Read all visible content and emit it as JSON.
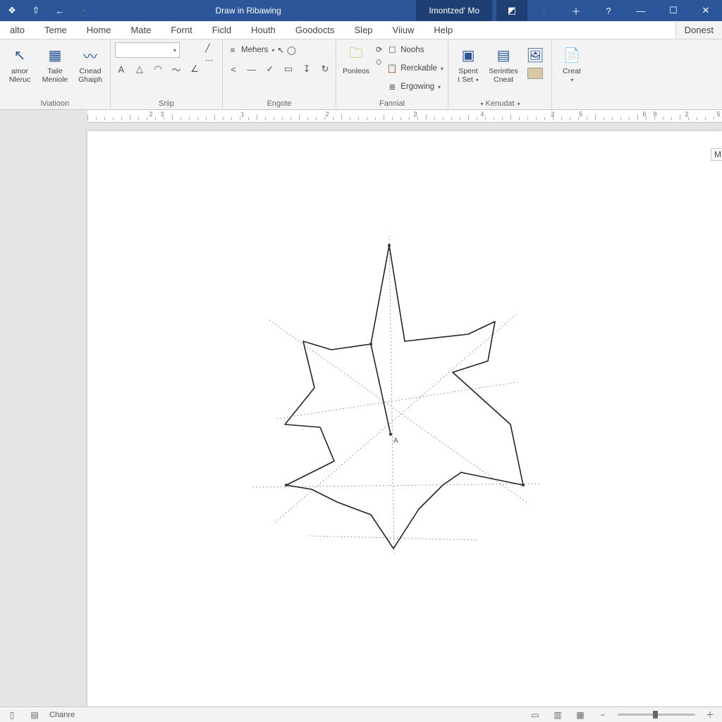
{
  "title_bar": {
    "doc_title": "Draw in  Ribawing",
    "mode_label": "Imontzed' Mo"
  },
  "tabs": [
    "alto",
    "Teme",
    "Home",
    "Mate",
    "Fornt",
    "Ficld",
    "Houth",
    "Goodocts",
    "Slep",
    "Viiuw",
    "Help"
  ],
  "right_button": "Donest",
  "ribbon": {
    "group1": {
      "btn1_top": "amor",
      "btn1_bot": "Nleruc",
      "btn2_top": "Taile",
      "btn2_bot": "Meniole",
      "btn3_top": "Cnead",
      "btn3_bot": "Ghaiph",
      "label": "lviatioon"
    },
    "group2": {
      "label": "Sriip",
      "combo_value": ""
    },
    "group3": {
      "top_label": "Mehers",
      "label": "Engote"
    },
    "group4": {
      "btn": "Ponleos",
      "label": "Fannial",
      "dd1": "Noohs",
      "dd2": "Rerckable",
      "dd3": "Ergowing"
    },
    "group5": {
      "btn1_top": "Spent",
      "btn1_bot": "I Set",
      "btn2_top": "Serinttes",
      "btn2_bot": "Cneat",
      "label": "Kenudat"
    },
    "group6": {
      "btn": "Creat"
    }
  },
  "ruler_numbers": [
    "2",
    "3",
    "1",
    "2",
    "3",
    "4",
    "2",
    "5",
    "6",
    "9",
    "2",
    "5"
  ],
  "canvas": {
    "center_label": "A",
    "margin_tag": "M"
  },
  "status": {
    "page_label": "Chanre"
  },
  "colors": {
    "brand": "#2b579a",
    "brand_dark": "#1e3f73",
    "chrome": "#f3f3f3",
    "workspace": "#e5e5e5"
  }
}
